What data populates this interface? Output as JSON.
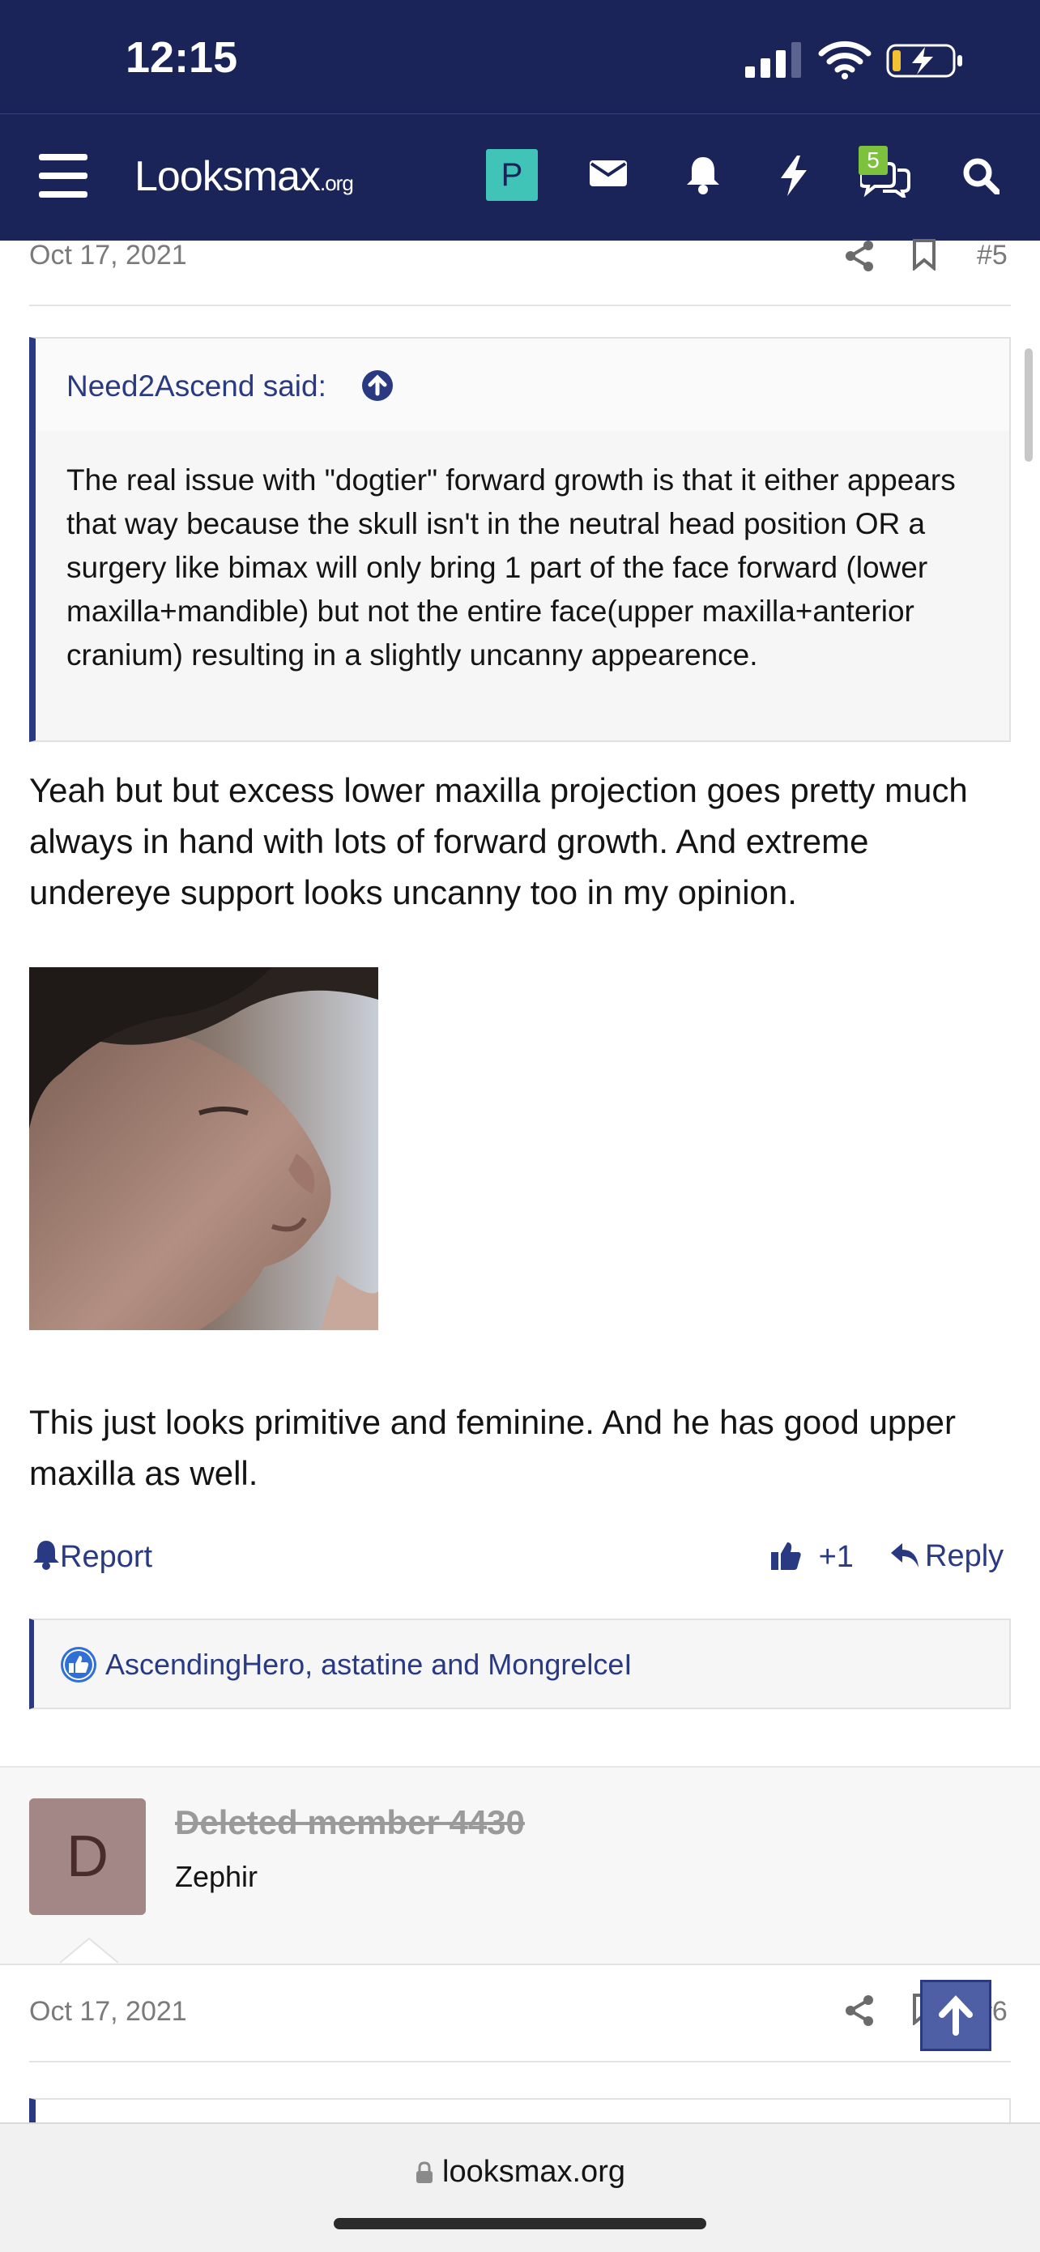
{
  "status_bar": {
    "time": "12:15"
  },
  "header": {
    "logo": "Lᴏᴏksmax",
    "logo_suffix": ".org",
    "user_initial": "P",
    "conversations_badge": "5"
  },
  "post5": {
    "date": "Oct 17, 2021",
    "number": "#5",
    "quote": {
      "author": "Need2Ascend said:",
      "text": "The real issue with \"dogtier\" forward growth is that it either appears that way because the skull isn't in the neutral head position OR a surgery like bimax will only bring 1 part of the face forward (lower maxilla+mandible) but not the entire face(upper maxilla+anterior cranium) resulting in a slightly uncanny appearence."
    },
    "text1": "Yeah but but excess lower maxilla projection goes pretty much always in hand with lots of forward growth. And extreme undereye support looks uncanny too in my opinion.",
    "text2": "This just looks primitive and feminine. And he has good upper maxilla as well.",
    "actions": {
      "report": "Report",
      "like_count": "+1",
      "reply": "Reply"
    },
    "likes": "AscendingHero, astatine and MongrelcеI"
  },
  "post6": {
    "member_initial": "D",
    "member_name": "Deleted member 4430",
    "member_title": "Zephir",
    "date": "Oct 17, 2021",
    "number": "#6"
  },
  "browser": {
    "url": "looksmax.org"
  },
  "colors": {
    "header_bg": "#1b2458",
    "accent": "#2a3a82",
    "avatar_p": "#40c4b8",
    "badge": "#7cc23d"
  }
}
